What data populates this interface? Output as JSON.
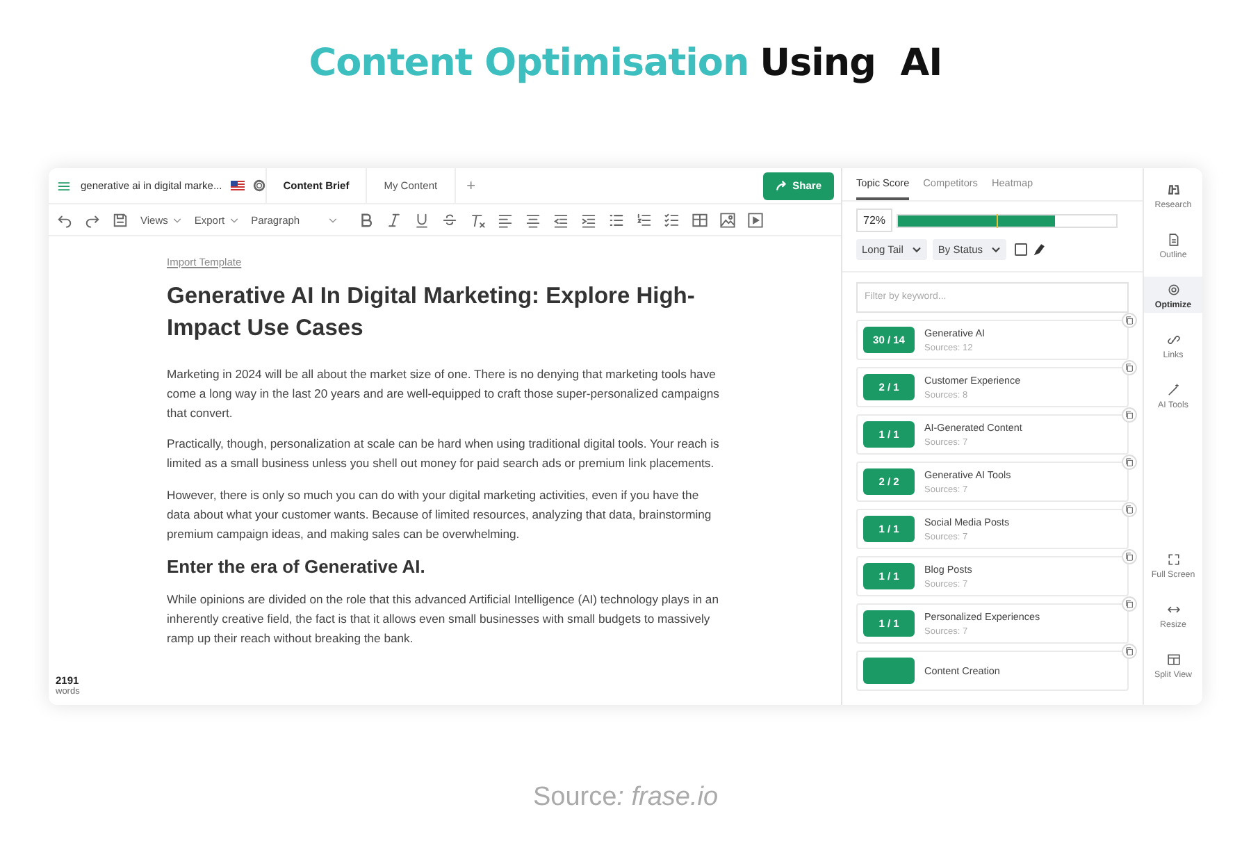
{
  "headline": {
    "highlight": "Content Optimisation",
    "rest": "Using  AI"
  },
  "editor": {
    "menu_title": "generative ai in digital marke...",
    "tabs": [
      {
        "label": "Content Brief",
        "selected": true
      },
      {
        "label": "My Content",
        "selected": false
      }
    ],
    "add_tab": "+",
    "share": "Share",
    "toolbar": {
      "views": "Views",
      "export": "Export",
      "paragraph": "Paragraph"
    },
    "import_link": "Import Template",
    "title": "Generative AI In Digital Marketing: Explore High-Impact Use Cases",
    "blocks": [
      {
        "kind": "p",
        "text": "Marketing in 2024 will be all about the market size of one. There is no denying that marketing tools have come a long way in the last 20 years and are well-equipped to craft those super-personalized campaigns that convert."
      },
      {
        "kind": "p",
        "text": "Practically, though, personalization at scale can be hard when using traditional digital tools. Your reach is limited as a small business unless you shell out money for paid search ads or premium link placements."
      },
      {
        "kind": "p",
        "text": "However, there is only so much you can do with your digital marketing activities, even if you have the data about what your customer wants. Because of limited resources, analyzing that data, brainstorming premium campaign ideas, and making sales can be overwhelming."
      },
      {
        "kind": "h2",
        "text": "Enter the era of Generative AI."
      },
      {
        "kind": "p",
        "text": "While opinions are divided on the role that this advanced Artificial Intelligence (AI) technology plays in an inherently creative field, the fact is that it allows even small businesses with small budgets to massively ramp up their reach without breaking the bank."
      }
    ],
    "word_count": "2191",
    "word_label": "words"
  },
  "panel": {
    "tabs": [
      {
        "label": "Topic Score",
        "selected": true
      },
      {
        "label": "Competitors",
        "selected": false
      },
      {
        "label": "Heatmap",
        "selected": false
      }
    ],
    "score": "72%",
    "meter": {
      "level": 0.72
    },
    "target": {
      "level": 0.45
    },
    "filters": [
      "Long Tail",
      "By Status"
    ],
    "highlight_toggle": {
      "checked": false
    },
    "search": {
      "placeholder": "Filter by keyword..."
    },
    "topics": [
      {
        "score": "30 / 14",
        "name": "Generative AI",
        "sources": "Sources: 12"
      },
      {
        "score": "2 / 1",
        "name": "Customer Experience",
        "sources": "Sources: 8"
      },
      {
        "score": "1 / 1",
        "name": "AI-Generated Content",
        "sources": "Sources: 7"
      },
      {
        "score": "2 / 2",
        "name": "Generative AI Tools",
        "sources": "Sources: 7"
      },
      {
        "score": "1 / 1",
        "name": "Social Media Posts",
        "sources": "Sources: 7"
      },
      {
        "score": "1 / 1",
        "name": "Blog Posts",
        "sources": "Sources: 7"
      },
      {
        "score": "1 / 1",
        "name": "Personalized Experiences",
        "sources": "Sources: 7"
      },
      {
        "name": "Content Creation"
      }
    ]
  },
  "side_nav": {
    "top": [
      {
        "label": "Research",
        "selected": false
      },
      {
        "label": "Outline",
        "selected": false
      },
      {
        "label": "Optimize",
        "selected": true
      },
      {
        "label": "Links",
        "selected": false
      },
      {
        "label": "AI Tools",
        "selected": false
      }
    ],
    "bottom": [
      {
        "label": "Full Screen",
        "selected": false
      },
      {
        "label": "Resize",
        "selected": false
      },
      {
        "label": "Split View",
        "selected": false
      }
    ]
  },
  "source": {
    "label": "Source",
    "value": ": frase.io"
  }
}
